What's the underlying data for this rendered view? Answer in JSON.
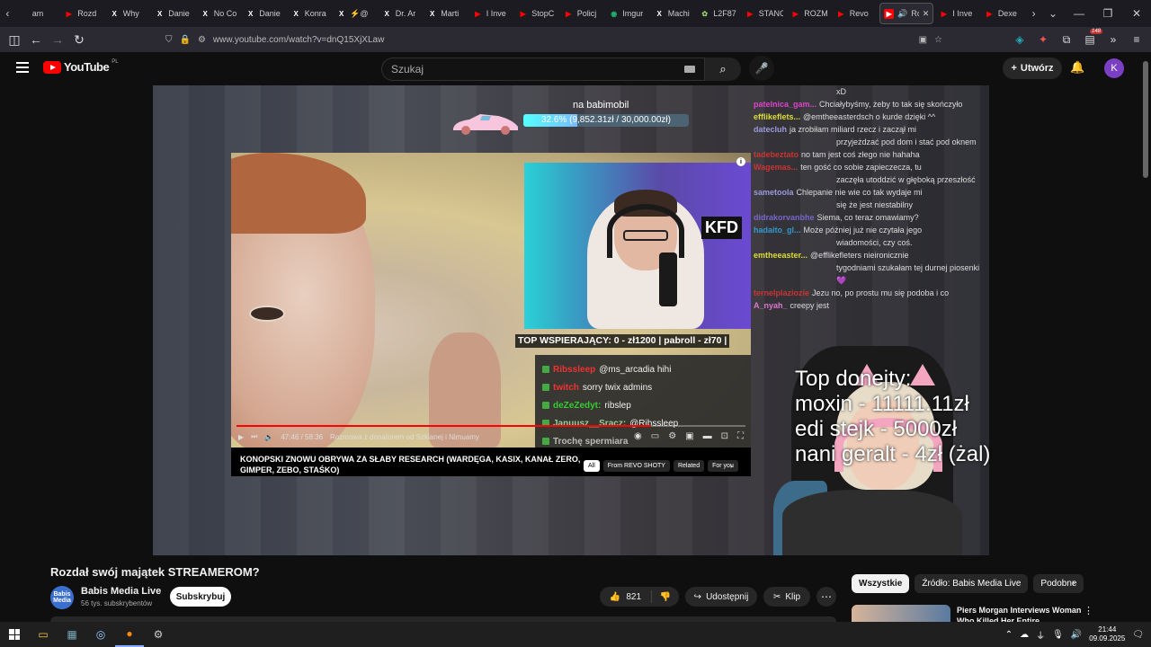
{
  "browser": {
    "tabs": [
      {
        "label": "am",
        "fav": "",
        "color": "#ccc"
      },
      {
        "label": "Rozd",
        "fav": "▶",
        "color": "#f00"
      },
      {
        "label": "Why",
        "fav": "X",
        "color": "#fff"
      },
      {
        "label": "Danie",
        "fav": "X",
        "color": "#fff"
      },
      {
        "label": "No Co",
        "fav": "X",
        "color": "#fff"
      },
      {
        "label": "Danie",
        "fav": "X",
        "color": "#fff"
      },
      {
        "label": "Konra",
        "fav": "X",
        "color": "#fff"
      },
      {
        "label": "⚡@",
        "fav": "X",
        "color": "#fff"
      },
      {
        "label": "Dr. Ar",
        "fav": "X",
        "color": "#fff"
      },
      {
        "label": "Marti",
        "fav": "X",
        "color": "#fff"
      },
      {
        "label": "I Inve",
        "fav": "▶",
        "color": "#f00"
      },
      {
        "label": "StopC",
        "fav": "▶",
        "color": "#f00"
      },
      {
        "label": "Policj",
        "fav": "▶",
        "color": "#f00"
      },
      {
        "label": "Imgur",
        "fav": "◉",
        "color": "#1bb76e"
      },
      {
        "label": "Machi",
        "fav": "X",
        "color": "#fff"
      },
      {
        "label": "L2F87",
        "fav": "✿",
        "color": "#9c6"
      },
      {
        "label": "STANC",
        "fav": "▶",
        "color": "#f00"
      },
      {
        "label": "ROZM",
        "fav": "▶",
        "color": "#f00"
      },
      {
        "label": "Revo",
        "fav": "▶",
        "color": "#f00"
      }
    ],
    "active_tab": {
      "label": "Roz",
      "fav": "▶"
    },
    "tabs_after": [
      {
        "label": "I Inve",
        "fav": "▶",
        "color": "#f00"
      },
      {
        "label": "Dexe",
        "fav": "▶",
        "color": "#f00"
      }
    ],
    "url": "www.youtube.com/watch?v=dnQ15XjXLaw",
    "badge_count": "148"
  },
  "youtube": {
    "logo_text": "YouTube",
    "region": "PL",
    "search_placeholder": "Szukaj",
    "create_label": "Utwórz",
    "avatar_letter": "K"
  },
  "stream": {
    "goal_title": "na babimobil",
    "goal_text": "32.6% (9,852.31zł / 30,000.00zł)",
    "goal_fraction": 0.326,
    "top_supporters": "TOP WSPIERAJĄCY: 0 - zł1200 |    pabroll - zł70 |",
    "top_donations": [
      "Top donejty:",
      "moxin - 11111.11zł",
      "edi stejk - 5000zł",
      "nani geralt - 4zł (żal)"
    ]
  },
  "embedded_video": {
    "time": "47:46 / 58:36",
    "chapter": "Rozmowa z donatorem od Szklanej i Nimuamy",
    "progress_fraction": 0.815,
    "title": "KONOPSKI ZNOWU OBRYWA ZA SŁABY RESEARCH (WARDĘGA, KASIX, KANAŁ ZERO, GIMPER, ZEBO, STAŚKO)",
    "chips": [
      "All",
      "From REVO SHOTY",
      "Related",
      "For you"
    ],
    "minichat": [
      {
        "user": "Ribssleep",
        "msg": "@ms_arcadia hihi",
        "ucolor": "#e33"
      },
      {
        "user": "twitch",
        "msg": "sorry twix admins",
        "ucolor": "#e33"
      },
      {
        "user": "deZeZedyt:",
        "msg": "ribslep",
        "ucolor": "#3c3"
      },
      {
        "user": "Januusz__Sracz:",
        "msg": "@Ribssleep",
        "ucolor": "#9c9"
      },
      {
        "user": "Trochę spermiara",
        "msg": "",
        "ucolor": "#bbb"
      }
    ]
  },
  "chat": [
    {
      "user": "",
      "msg": "xD",
      "ucolor": "#aaa"
    },
    {
      "user": "patelnica_gam...",
      "msg": "Chciałybyśmy, żeby to tak się skończyło",
      "ucolor": "#d4c"
    },
    {
      "user": "efflikeflets...",
      "msg": "@emtheeasterdsch o kurde dzięki ^^",
      "ucolor": "#dd3"
    },
    {
      "user": "datecluh",
      "msg": "ja zrobiłam miliard rzecz i zaczął mi",
      "ucolor": "#99d"
    },
    {
      "user": "",
      "msg": "przyjeżdzać pod dom i stać pod oknem",
      "ucolor": "#aaa"
    },
    {
      "user": "tadebeztato",
      "msg": "no tam jest coś złego nie hahaha",
      "ucolor": "#c33"
    },
    {
      "user": "Wagemas...",
      "msg": "ten gość co sobie zapieczecza, tu",
      "ucolor": "#c33"
    },
    {
      "user": "",
      "msg": "zaczęła utoddzić w głęboką przeszłość",
      "ucolor": "#aaa"
    },
    {
      "user": "sametoola",
      "msg": "Chlepanie nie wie co tak wydaje mi",
      "ucolor": "#99d"
    },
    {
      "user": "",
      "msg": "się że jest niestabilny",
      "ucolor": "#aaa"
    },
    {
      "user": "didrakorvanbhe",
      "msg": "Siema, co teraz omawiamy?",
      "ucolor": "#76c"
    },
    {
      "user": "hadaito_gl...",
      "msg": "Może później już nie czytała jego",
      "ucolor": "#39c"
    },
    {
      "user": "",
      "msg": "wiadomości, czy coś.",
      "ucolor": "#aaa"
    },
    {
      "user": "emtheeaster...",
      "msg": "@efflikefleters nieironicznie",
      "ucolor": "#dd3"
    },
    {
      "user": "",
      "msg": "tygodniami szukałam tej durnej piosenki",
      "ucolor": "#aaa"
    },
    {
      "user": "",
      "msg": "💜",
      "ucolor": "#aaa"
    },
    {
      "user": "ternelplaziozie",
      "msg": "Jezu no, po prostu mu się podoba i co",
      "ucolor": "#c33"
    },
    {
      "user": "A_nyah_",
      "msg": "creepy jest",
      "ucolor": "#d7c"
    }
  ],
  "video": {
    "title": "Rozdał swój majątek STREAMEROM?",
    "channel": "Babis Media Live",
    "channel_avatar_text": "Babis Media",
    "subscribers": "56 tys. subskrybentów",
    "subscribe_label": "Subskrybuj",
    "likes": "821",
    "share_label": "Udostępnij",
    "clip_label": "Klip"
  },
  "related": {
    "chips": [
      "Wszystkie",
      "Źródło: Babis Media Live",
      "Podobne"
    ],
    "first_title": "Piers Morgan Interviews Woman Who Killed Her Entire"
  },
  "taskbar": {
    "time": "21:44",
    "date": "09.09.2025"
  }
}
